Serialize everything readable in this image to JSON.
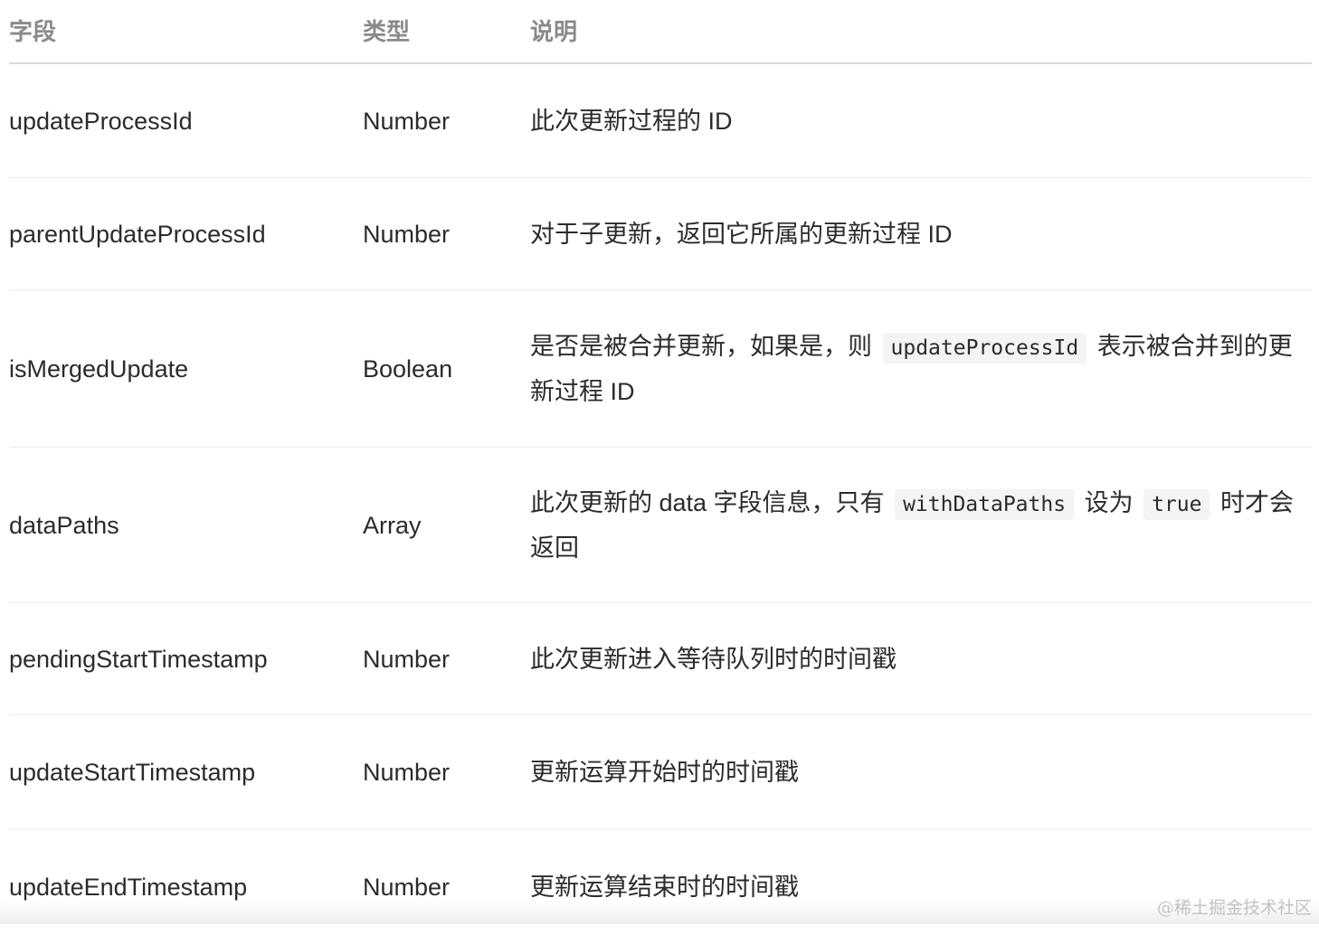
{
  "table": {
    "headers": {
      "field": "字段",
      "type": "类型",
      "description": "说明"
    },
    "rows": [
      {
        "field": "updateProcessId",
        "type": "Number",
        "description": [
          {
            "text": "此次更新过程的 ID"
          }
        ]
      },
      {
        "field": "parentUpdateProcessId",
        "type": "Number",
        "description": [
          {
            "text": "对于子更新，返回它所属的更新过程 ID"
          }
        ]
      },
      {
        "field": "isMergedUpdate",
        "type": "Boolean",
        "description": [
          {
            "text": "是否是被合并更新，如果是，则 "
          },
          {
            "code": "updateProcessId"
          },
          {
            "text": " 表示被合并到的更新过程 ID"
          }
        ]
      },
      {
        "field": "dataPaths",
        "type": "Array",
        "description": [
          {
            "text": "此次更新的 data 字段信息，只有 "
          },
          {
            "code": "withDataPaths"
          },
          {
            "text": " 设为 "
          },
          {
            "code": "true"
          },
          {
            "text": " 时才会返回"
          }
        ]
      },
      {
        "field": "pendingStartTimestamp",
        "type": "Number",
        "description": [
          {
            "text": "此次更新进入等待队列时的时间戳"
          }
        ]
      },
      {
        "field": "updateStartTimestamp",
        "type": "Number",
        "description": [
          {
            "text": "更新运算开始时的时间戳"
          }
        ]
      },
      {
        "field": "updateEndTimestamp",
        "type": "Number",
        "description": [
          {
            "text": "更新运算结束时的时间戳"
          }
        ]
      }
    ]
  },
  "watermark": "@稀土掘金技术社区"
}
